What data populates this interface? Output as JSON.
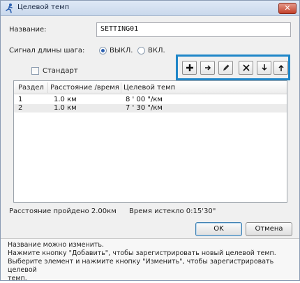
{
  "window": {
    "title": "Целевой темп",
    "close_label": "✕"
  },
  "form": {
    "name_label": "Название:",
    "name_value": "SETTING01",
    "signal_label": "Сигнал длины шага:",
    "radio_off_label": "ВЫКЛ.",
    "radio_on_label": "ВКЛ.",
    "standard_label": "Стандарт"
  },
  "toolbar": {
    "buttons": [
      {
        "name": "add",
        "icon": "plus-icon"
      },
      {
        "name": "move",
        "icon": "arrow-right-icon"
      },
      {
        "name": "edit",
        "icon": "pencil-icon"
      },
      {
        "name": "delete",
        "icon": "x-icon"
      },
      {
        "name": "down",
        "icon": "arrow-down-icon"
      },
      {
        "name": "up",
        "icon": "arrow-up-icon"
      }
    ]
  },
  "table": {
    "columns": [
      "Раздел",
      "Расстояние /время",
      "Целевой темп"
    ],
    "rows": [
      [
        "1",
        "1.0 км",
        "8 ' 00 \"/км"
      ],
      [
        "2",
        "1.0 км",
        "7 ' 30 \"/км"
      ]
    ]
  },
  "status": {
    "distance": "Расстояние пройдено 2.00км",
    "time": "Время истекло 0:15'30\""
  },
  "buttons": {
    "ok": "OK",
    "cancel": "Отмена"
  },
  "help": {
    "line1": "Название можно изменить.",
    "line2": "Нажмите кнопку \"Добавить\", чтобы зарегистрировать новый целевой темп.",
    "line3": "Выберите элемент и нажмите кнопку \"Изменить\", чтобы зарегистрировать целевой",
    "line4": "темп."
  },
  "colors": {
    "accent": "#1f86c8",
    "radio_dot": "#2a5fb0",
    "close": "#c3412b"
  }
}
